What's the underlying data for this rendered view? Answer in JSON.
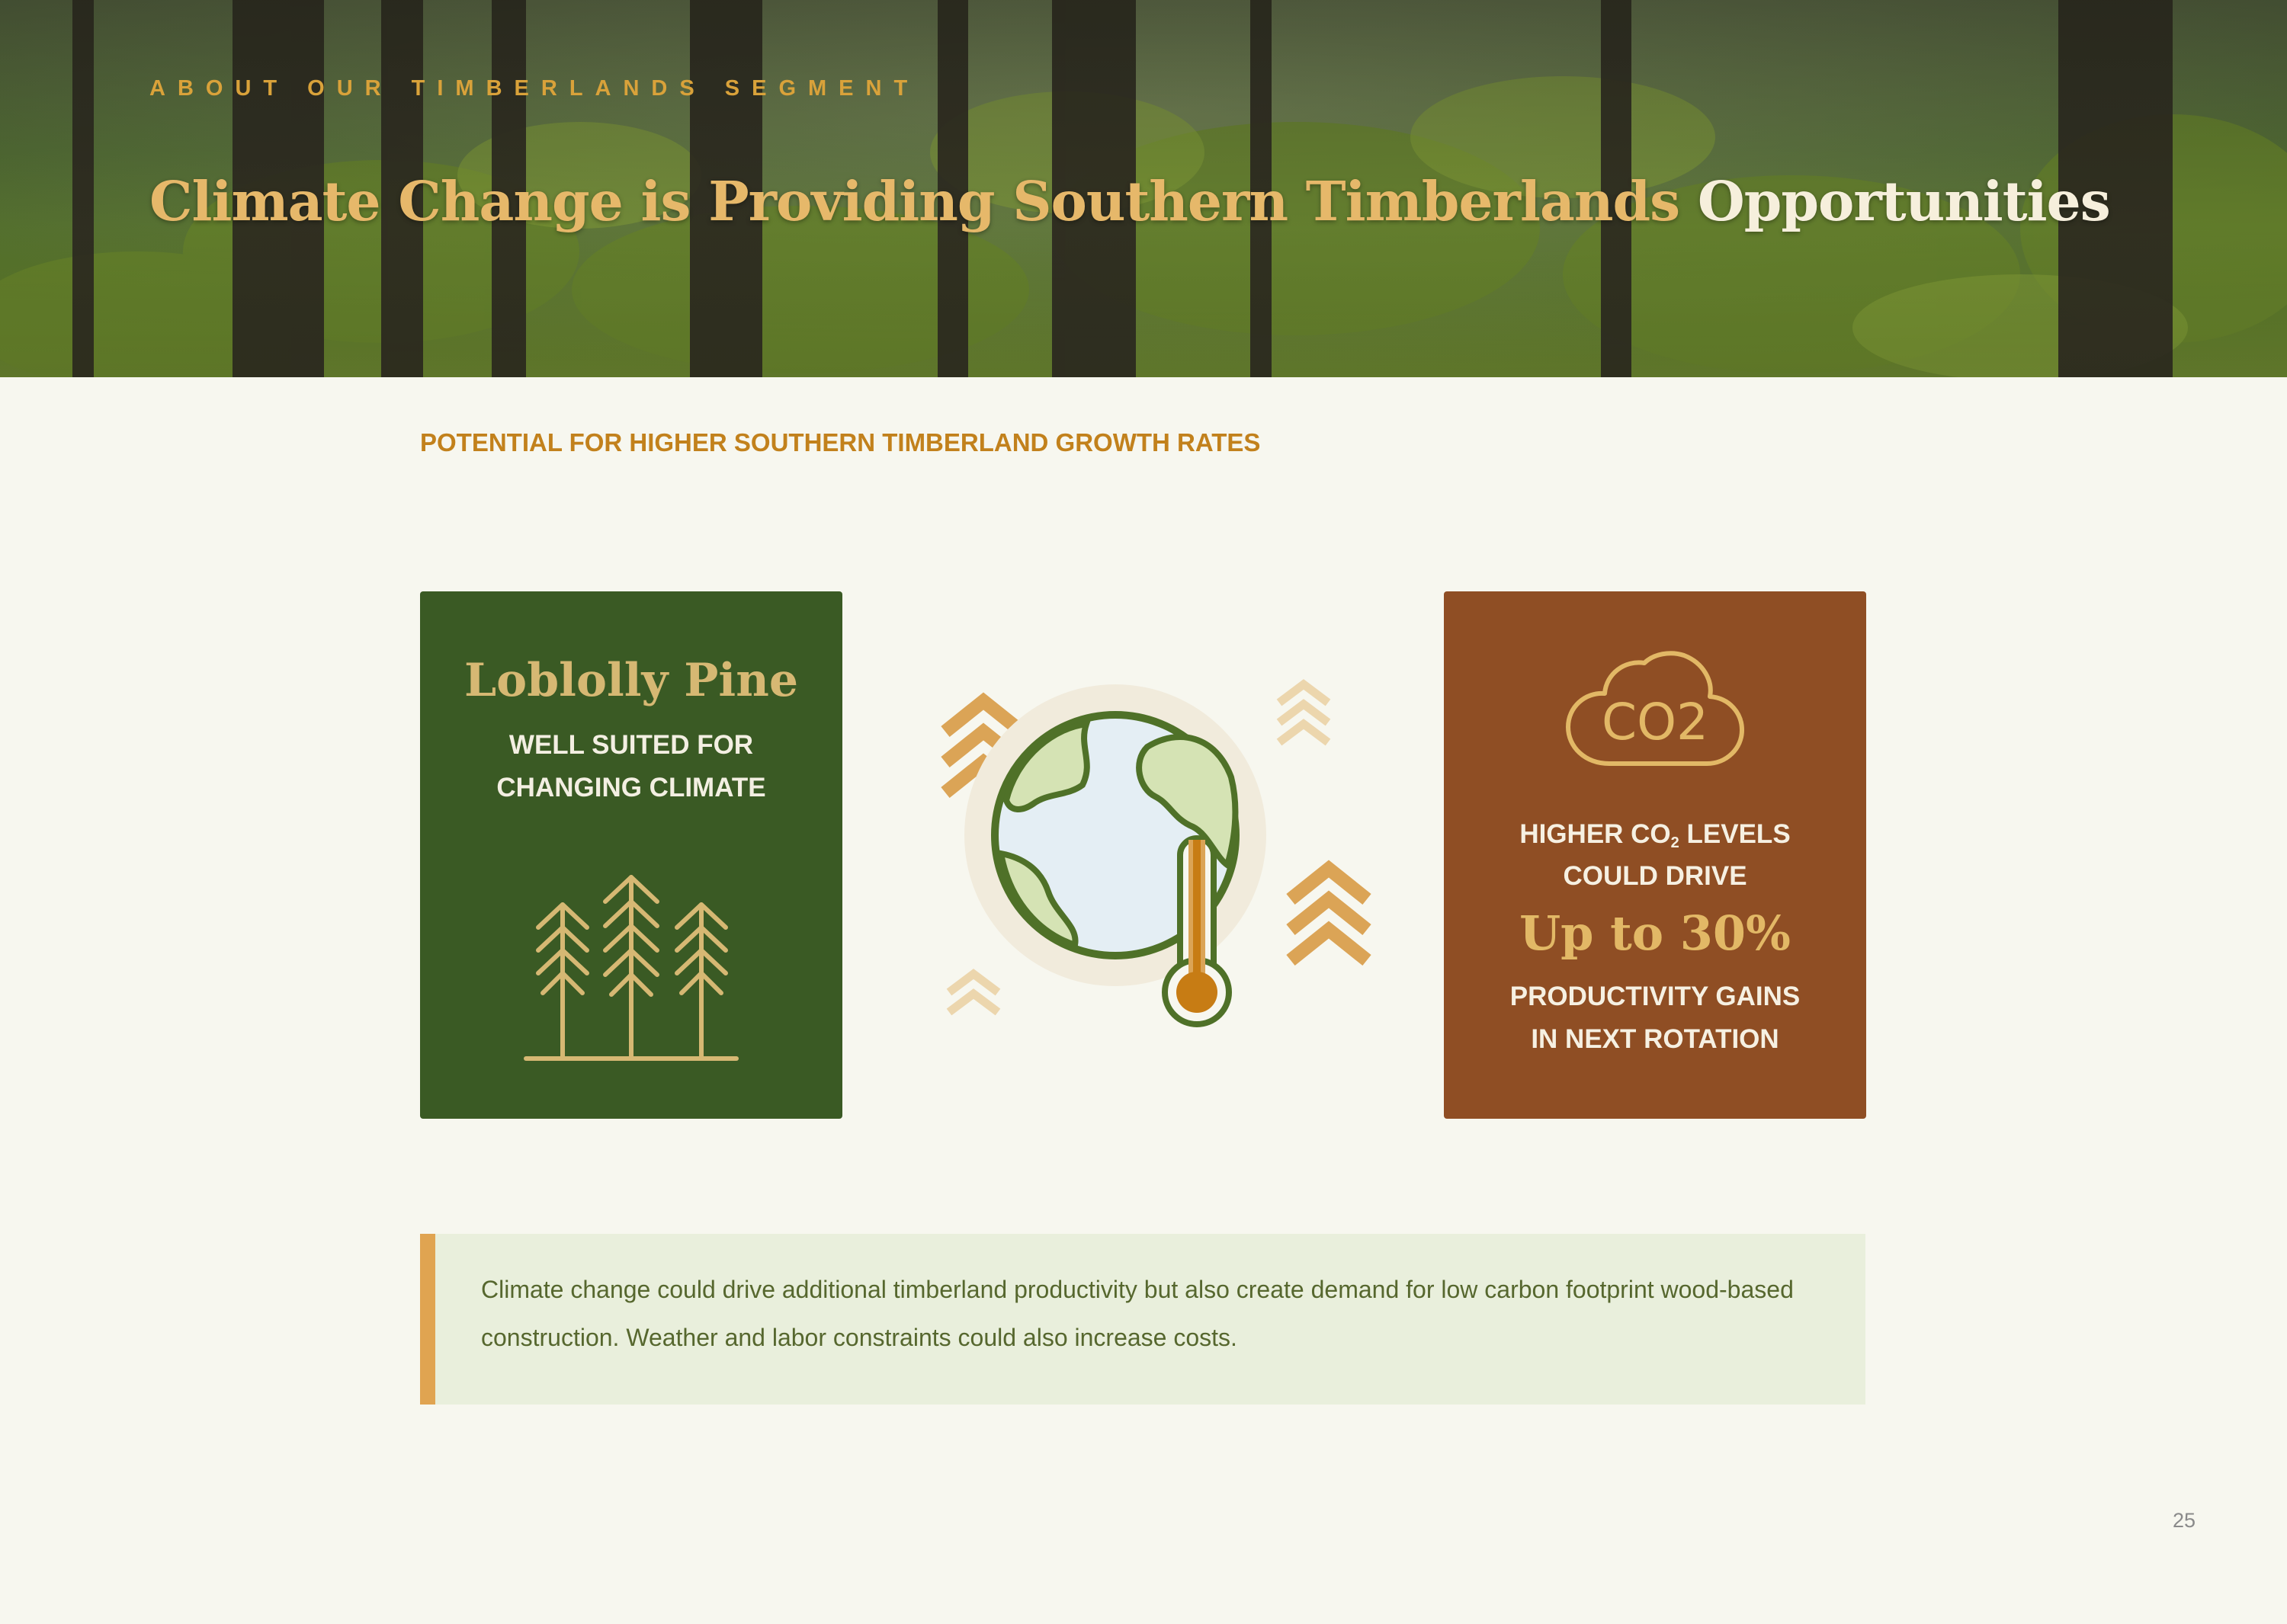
{
  "header": {
    "eyebrow": "ABOUT OUR TIMBERLANDS SEGMENT",
    "title_main": "Climate Change is Providing Southern Timberlands",
    "title_highlight": "Opportunities"
  },
  "section_heading": "POTENTIAL FOR HIGHER SOUTHERN TIMBERLAND GROWTH RATES",
  "pine_card": {
    "title": "Loblolly Pine",
    "line1": "WELL SUITED FOR",
    "line2": "CHANGING CLIMATE",
    "icon": "pine-trees-icon"
  },
  "center_graphic": {
    "icon": "globe-thermometer-icon"
  },
  "co2_card": {
    "cloud_label": "CO2",
    "line1_prefix": "HIGHER CO",
    "line1_sub": "2",
    "line1_suffix": " LEVELS",
    "line2": "COULD DRIVE",
    "highlight": "Up to 30%",
    "line4": "PRODUCTIVITY GAINS",
    "line5": "IN NEXT ROTATION",
    "icon": "co2-cloud-icon"
  },
  "callout": {
    "text": "Climate change could drive additional timberland productivity but also create demand for low carbon footprint wood-based construction. Weather and labor constraints could also increase costs."
  },
  "page_number": "25",
  "colors": {
    "background": "#f7f7ef",
    "green_card": "#3a5a24",
    "brown_card": "#8f4e24",
    "gold": "#d9a23a",
    "callout_bg": "#e9efdc",
    "callout_bar": "#e0a451"
  }
}
